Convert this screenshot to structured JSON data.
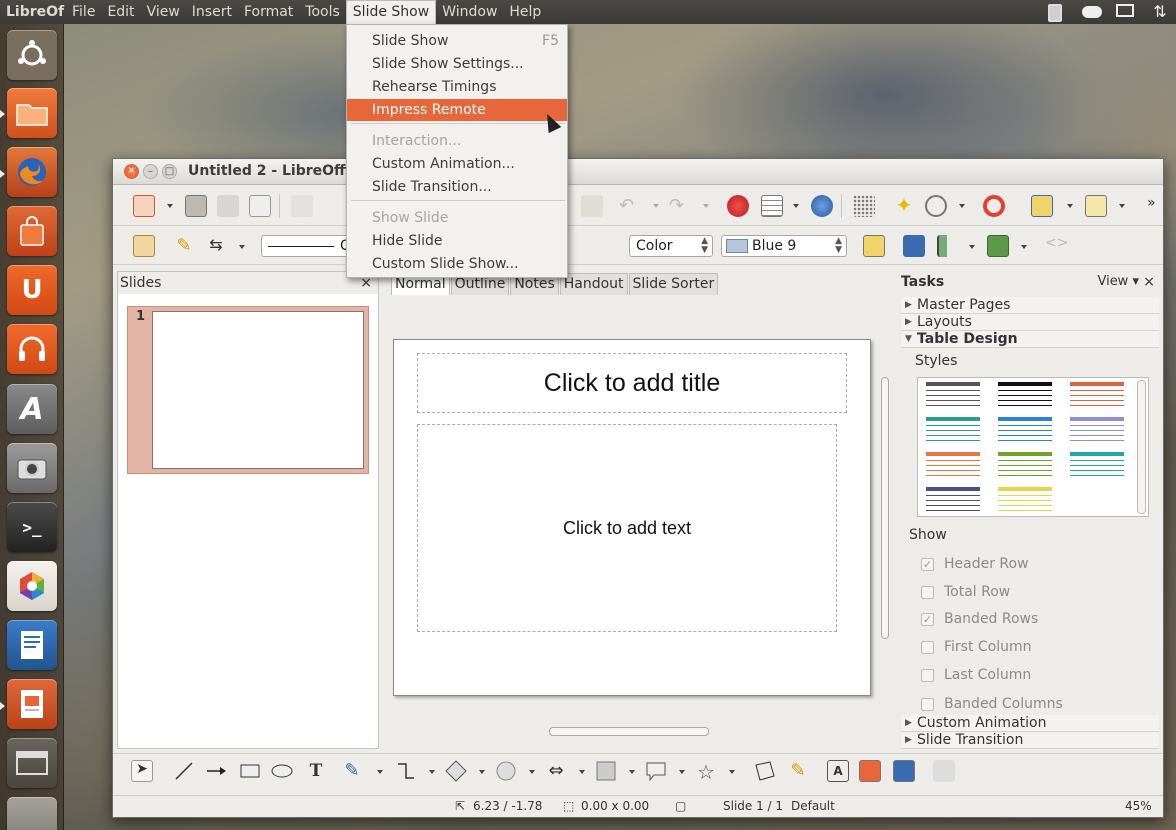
{
  "panel": {
    "app_name": "LibreOf",
    "menus": [
      "File",
      "Edit",
      "View",
      "Insert",
      "Format",
      "Tools",
      "Slide Show",
      "Window",
      "Help"
    ],
    "active_menu_index": 6,
    "indicators": [
      "clipboard-icon",
      "cloud-icon",
      "mail-icon",
      "network-icon"
    ]
  },
  "launcher": {
    "items": [
      {
        "name": "ubuntu-home",
        "icon": "ubuntu-logo-icon",
        "color": "#7a6f5f"
      },
      {
        "name": "files",
        "icon": "folder-icon",
        "color": "#e0601e"
      },
      {
        "name": "firefox",
        "icon": "firefox-icon",
        "color": "#d05820"
      },
      {
        "name": "software-center",
        "icon": "shopping-bag-icon",
        "color": "#d2461c"
      },
      {
        "name": "ubuntu-one",
        "icon": "ubuntu-one-icon",
        "color": "#e0501a"
      },
      {
        "name": "ubuntu-one-music",
        "icon": "headphones-icon",
        "color": "#d94a18"
      },
      {
        "name": "font-viewer",
        "icon": "font-a-icon",
        "color": "#7b7b7b"
      },
      {
        "name": "camera",
        "icon": "camera-icon",
        "color": "#8a8a8a"
      },
      {
        "name": "terminal",
        "icon": "terminal-icon",
        "color": "#3a3a3a"
      },
      {
        "name": "color-app",
        "icon": "color-wheel-icon",
        "color": "#e6e3dd"
      },
      {
        "name": "writer",
        "icon": "writer-document-icon",
        "color": "#2f6cb8"
      },
      {
        "name": "impress",
        "icon": "impress-presentation-icon",
        "color": "#d0521f"
      },
      {
        "name": "workspaces",
        "icon": "workspace-switcher-icon",
        "color": "#5c5750"
      },
      {
        "name": "trash",
        "icon": "trash-icon",
        "color": "#8f8c86"
      }
    ]
  },
  "window": {
    "title": "Untitled 2 - LibreOffic"
  },
  "toolbar2": {
    "line_style": "C",
    "area_style": "Color",
    "color_name": "Blue 9"
  },
  "slides_pane": {
    "title": "Slides",
    "close": "×",
    "slide_number": "1"
  },
  "view_tabs": [
    "Normal",
    "Outline",
    "Notes",
    "Handout",
    "Slide Sorter"
  ],
  "slide": {
    "title_placeholder": "Click to add title",
    "body_placeholder": "Click to add text"
  },
  "tasks_pane": {
    "title": "Tasks",
    "view": "View",
    "close": "×",
    "sections_top": [
      "Master Pages",
      "Layouts",
      "Table Design"
    ],
    "styles_label": "Styles",
    "show_label": "Show",
    "options": [
      {
        "label": "Header Row",
        "checked": true
      },
      {
        "label": "Total Row",
        "checked": false
      },
      {
        "label": "Banded Rows",
        "checked": true
      },
      {
        "label": "First Column",
        "checked": false
      },
      {
        "label": "Last Column",
        "checked": false
      },
      {
        "label": "Banded Columns",
        "checked": false
      }
    ],
    "sections_bottom": [
      "Custom Animation",
      "Slide Transition"
    ],
    "table_style_colors": [
      "#555555",
      "#111111",
      "#e2613a",
      "#2a9d8f",
      "#2b7fd6",
      "#8c8ed8",
      "#e8743f",
      "#6fa32a",
      "#1fa7a7",
      "#4a4f8c",
      "#e8d44a"
    ]
  },
  "status": {
    "position": "6.23 / -1.78",
    "size": "0.00 x 0.00",
    "slide": "Slide 1 / 1",
    "layout": "Default",
    "zoom": "45%"
  },
  "dropdown": {
    "items": [
      {
        "label": "Slide Show",
        "shortcut": "F5",
        "state": "normal"
      },
      {
        "label": "Slide Show Settings...",
        "shortcut": "",
        "state": "normal"
      },
      {
        "label": "Rehearse Timings",
        "shortcut": "",
        "state": "normal"
      },
      {
        "label": "Impress Remote",
        "shortcut": "",
        "state": "highlighted"
      },
      {
        "label": "Interaction...",
        "shortcut": "",
        "state": "disabled"
      },
      {
        "label": "Custom Animation...",
        "shortcut": "",
        "state": "normal"
      },
      {
        "label": "Slide Transition...",
        "shortcut": "",
        "state": "normal"
      },
      {
        "label": "Show Slide",
        "shortcut": "",
        "state": "disabled"
      },
      {
        "label": "Hide Slide",
        "shortcut": "",
        "state": "normal"
      },
      {
        "label": "Custom Slide Show...",
        "shortcut": "",
        "state": "normal"
      }
    ]
  }
}
